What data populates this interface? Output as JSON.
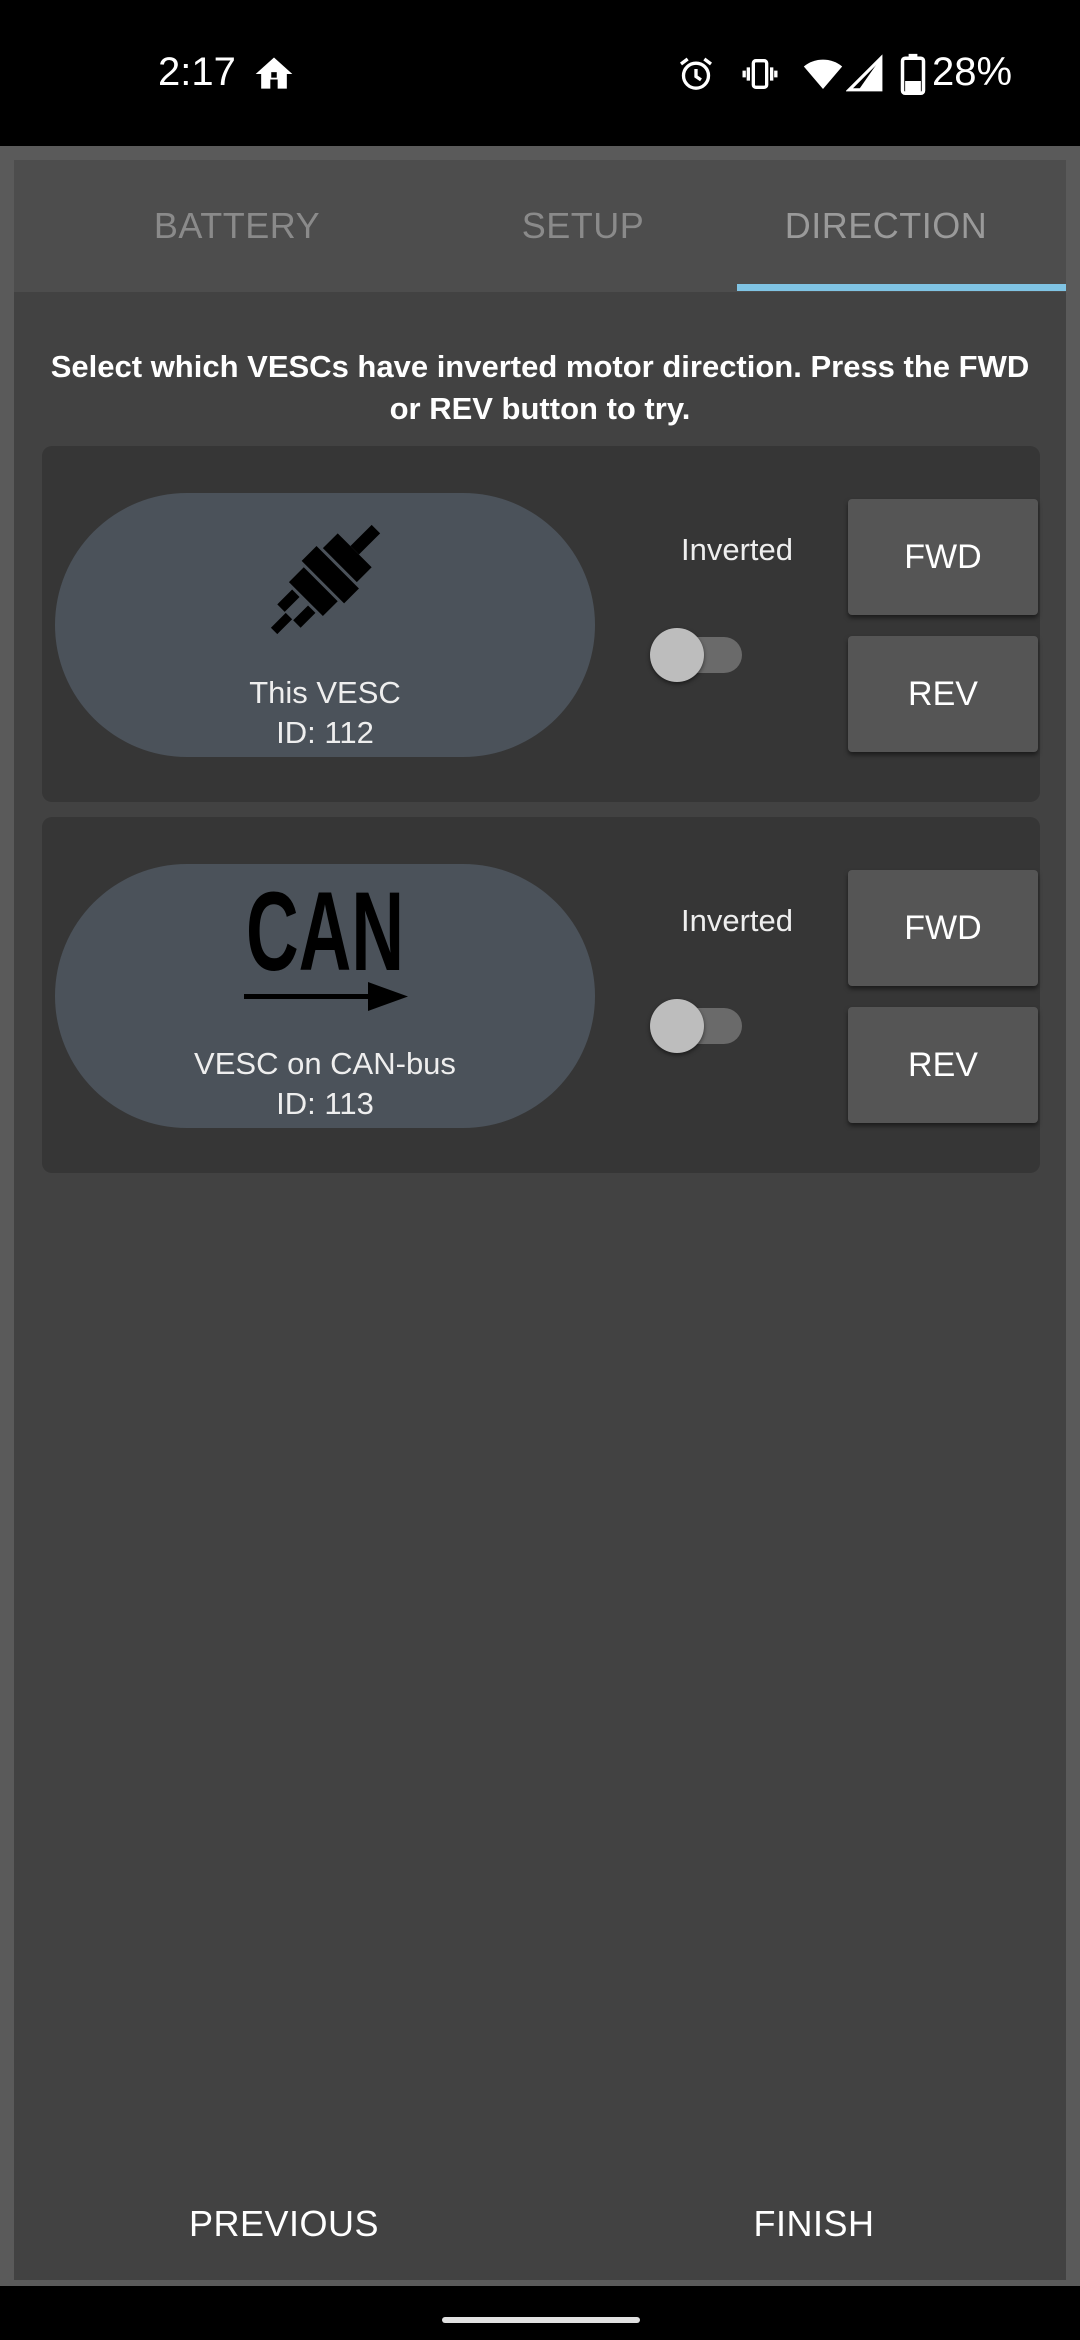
{
  "status_bar": {
    "time": "2:17",
    "battery_percent": "28%",
    "icons": [
      "home-icon",
      "alarm-icon",
      "vibrate-icon",
      "wifi-icon",
      "signal-icon",
      "battery-icon"
    ]
  },
  "tabs": [
    {
      "label": "BATTERY",
      "selected": false
    },
    {
      "label": "SETUP",
      "selected": false
    },
    {
      "label": "DIRECTION",
      "selected": true
    }
  ],
  "colors": {
    "tab_indicator": "#80c4e4",
    "dialog_bg": "#424242",
    "card_bg": "#363636",
    "pill_bg": "#4b525a"
  },
  "instructions": "Select which VESCs have inverted motor direction. Press the FWD or REV button to try.",
  "vescs": [
    {
      "icon": "plug-icon",
      "name": "This VESC",
      "id_text": "ID: 112",
      "inverted_label": "Inverted",
      "inverted": false,
      "fwd_label": "FWD",
      "rev_label": "REV"
    },
    {
      "icon": "can-bus-icon",
      "icon_text": "CAN",
      "name": "VESC on CAN-bus",
      "id_text": "ID: 113",
      "inverted_label": "Inverted",
      "inverted": false,
      "fwd_label": "FWD",
      "rev_label": "REV"
    }
  ],
  "footer": {
    "previous_label": "PREVIOUS",
    "finish_label": "FINISH"
  }
}
